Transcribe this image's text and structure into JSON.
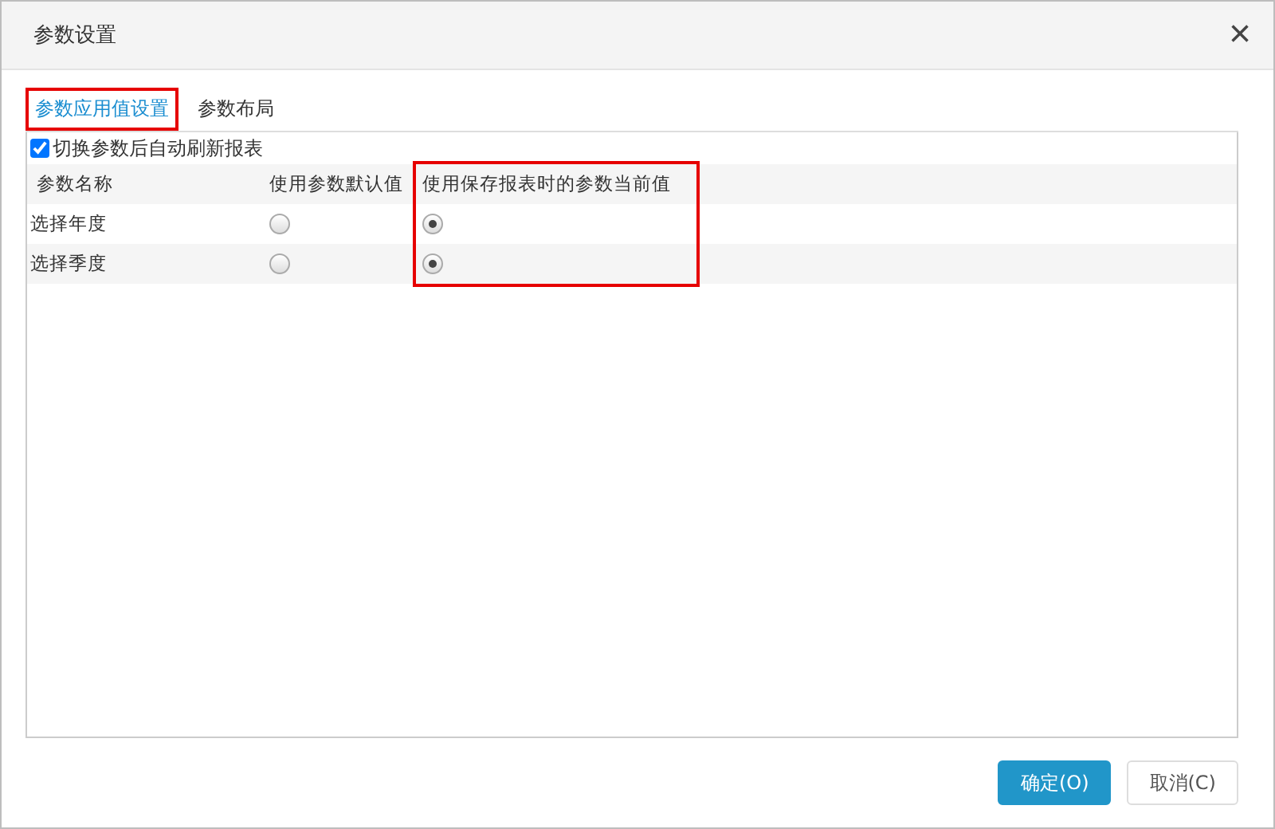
{
  "window": {
    "title": "参数设置",
    "close": "×"
  },
  "tabs": [
    {
      "label": "参数应用值设置",
      "selected": true,
      "highlighted": true
    },
    {
      "label": "参数布局",
      "selected": false,
      "highlighted": false
    }
  ],
  "auto_refresh": {
    "label": "切换参数后自动刷新报表",
    "checked": true
  },
  "table": {
    "columns": [
      {
        "label": "参数名称",
        "highlighted": false
      },
      {
        "label": "使用参数默认值",
        "highlighted": false
      },
      {
        "label": "使用保存报表时的参数当前值",
        "highlighted": true
      }
    ],
    "rows": [
      {
        "name": "选择年度",
        "options": [
          {
            "selected": false
          },
          {
            "selected": true
          }
        ]
      },
      {
        "name": "选择季度",
        "options": [
          {
            "selected": false
          },
          {
            "selected": true
          }
        ]
      }
    ]
  },
  "buttons": [
    {
      "label": "确定(O)",
      "kind": "primary"
    },
    {
      "label": "取消(C)",
      "kind": "secondary"
    }
  ]
}
